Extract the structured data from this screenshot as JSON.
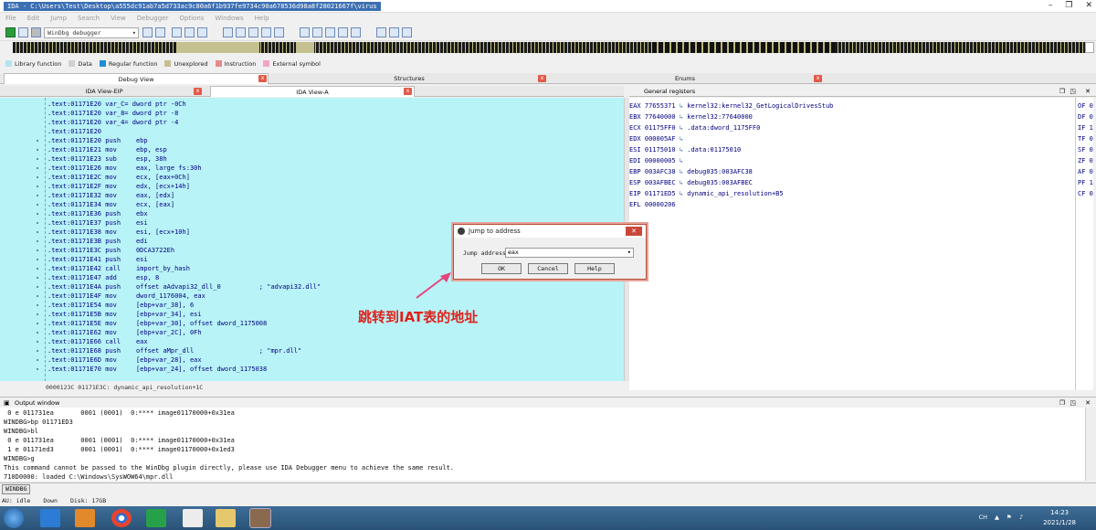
{
  "window": {
    "title": "IDA - C:\\Users\\Test\\Desktop\\a555dc91ab7a5d733ac9c80a6f1b937fe9734c90a678536d98a8f28021667f\\virus",
    "controls": [
      "–",
      "❐",
      "✕"
    ]
  },
  "menu": [
    "File",
    "Edit",
    "Jump",
    "Search",
    "View",
    "Debugger",
    "Options",
    "Windows",
    "Help"
  ],
  "toolbar": {
    "debugger_select": "WinDbg debugger"
  },
  "legend": [
    {
      "label": "Library function",
      "color": "#b5e3f3"
    },
    {
      "label": "Data",
      "color": "#d0d0d0"
    },
    {
      "label": "Regular function",
      "color": "#1e8fd6"
    },
    {
      "label": "Unexplored",
      "color": "#c4c08f"
    },
    {
      "label": "Instruction",
      "color": "#e88a8a"
    },
    {
      "label": "External symbol",
      "color": "#f2a3c6"
    }
  ],
  "top_tabs": [
    {
      "label": "Debug View"
    },
    {
      "label": "Structures"
    },
    {
      "label": "Enums"
    }
  ],
  "view_tabs": [
    {
      "label": "IDA View-EIP"
    },
    {
      "label": "IDA View-A"
    }
  ],
  "registers_title": "General registers",
  "disasm": [
    {
      "addr": ".text:01171E20",
      "text": " var_C= dword ptr -0Ch"
    },
    {
      "addr": ".text:01171E20",
      "text": " var_8= dword ptr -8"
    },
    {
      "addr": ".text:01171E20",
      "text": " var_4= dword ptr -4"
    },
    {
      "addr": ".text:01171E20",
      "text": ""
    },
    {
      "addr": ".text:01171E20",
      "text": " push    ebp"
    },
    {
      "addr": ".text:01171E21",
      "text": " mov     ebp, esp"
    },
    {
      "addr": ".text:01171E23",
      "text": " sub     esp, 38h"
    },
    {
      "addr": ".text:01171E26",
      "text": " mov     eax, large fs:30h"
    },
    {
      "addr": ".text:01171E2C",
      "text": " mov     ecx, [eax+0Ch]"
    },
    {
      "addr": ".text:01171E2F",
      "text": " mov     edx, [ecx+14h]"
    },
    {
      "addr": ".text:01171E32",
      "text": " mov     eax, [edx]"
    },
    {
      "addr": ".text:01171E34",
      "text": " mov     ecx, [eax]"
    },
    {
      "addr": ".text:01171E36",
      "text": " push    ebx"
    },
    {
      "addr": ".text:01171E37",
      "text": " push    esi"
    },
    {
      "addr": ".text:01171E38",
      "text": " mov     esi, [ecx+10h]"
    },
    {
      "addr": ".text:01171E3B",
      "text": " push    edi"
    },
    {
      "addr": ".text:01171E3C",
      "text": " push    0DCA3722Eh"
    },
    {
      "addr": ".text:01171E41",
      "text": " push    esi"
    },
    {
      "addr": ".text:01171E42",
      "text": " call    import_by_hash"
    },
    {
      "addr": ".text:01171E47",
      "text": " add     esp, 8"
    },
    {
      "addr": ".text:01171E4A",
      "text": " push    offset aAdvapi32_dll_0          ; \"advapi32.dll\""
    },
    {
      "addr": ".text:01171E4F",
      "text": " mov     dword_1176004, eax"
    },
    {
      "addr": ".text:01171E54",
      "text": " mov     [ebp+var_38], 6"
    },
    {
      "addr": ".text:01171E5B",
      "text": " mov     [ebp+var_34], esi"
    },
    {
      "addr": ".text:01171E5E",
      "text": " mov     [ebp+var_30], offset dword_1175008"
    },
    {
      "addr": ".text:01171E62",
      "text": " mov     [ebp+var_2C], 0Fh"
    },
    {
      "addr": ".text:01171E66",
      "text": " call    eax"
    },
    {
      "addr": ".text:01171E68",
      "text": " push    offset aMpr_dll                 ; \"mpr.dll\""
    },
    {
      "addr": ".text:01171E6D",
      "text": " mov     [ebp+var_28], eax"
    },
    {
      "addr": ".text:01171E70",
      "text": " mov     [ebp+var_24], offset dword_1175038"
    }
  ],
  "disasm_status": "0000123C 01171E3C: dynamic_api_resolution+1C",
  "registers": [
    {
      "name": "EAX",
      "value": "77655371",
      "target": "kernel32:kernel32_GetLogicalDrivesStub"
    },
    {
      "name": "EBX",
      "value": "77640000",
      "target": "kernel32:77640000"
    },
    {
      "name": "ECX",
      "value": "01175FF0",
      "target": ".data:dword_1175FF0"
    },
    {
      "name": "EDX",
      "value": "000005AF",
      "target": ""
    },
    {
      "name": "ESI",
      "value": "01175010",
      "target": ".data:01175010"
    },
    {
      "name": "EDI",
      "value": "00000005",
      "target": ""
    },
    {
      "name": "EBP",
      "value": "003AFC38",
      "target": "debug035:003AFC38"
    },
    {
      "name": "ESP",
      "value": "003AFBEC",
      "target": "debug035:003AFBEC"
    },
    {
      "name": "EIP",
      "value": "01171ED5",
      "target": "dynamic_api_resolution+B5"
    },
    {
      "name": "EFL",
      "value": "00000206",
      "target": ""
    }
  ],
  "flags": [
    "OF 0",
    "DF 0",
    "IF 1",
    "TF 0",
    "SF 0",
    "ZF 0",
    "AF 0",
    "PF 1",
    "CF 0"
  ],
  "dialog": {
    "title": "Jump to address",
    "label": "Jump address",
    "value": "eax",
    "ok": "OK",
    "cancel": "Cancel",
    "help": "Help"
  },
  "annotation": "跳转到IAT表的地址",
  "output_title": "Output window",
  "output": [
    " 0 e 011731ea       0001 (0001)  0:**** image01170000+0x31ea",
    "WINDBG>bp 01171ED3",
    "WINDBG>bl",
    " 0 e 011731ea       0001 (0001)  0:**** image01170000+0x31ea",
    " 1 e 01171ed3       0001 (0001)  0:**** image01170000+0x1ed3",
    "WINDBG>g",
    "This command cannot be passed to the WinDbg plugin directly, please use IDA Debugger menu to achieve the same result.",
    "710D0000: loaded C:\\Windows\\SysWOW64\\mpr.dll"
  ],
  "cmd_button": "WINDBG",
  "status": [
    "AU:  idle",
    "Down",
    "Disk: 17GB"
  ],
  "clock": {
    "time": "14:23",
    "date": "2021/1/28"
  },
  "tray": [
    "CH",
    "▲",
    "⚑",
    "♪"
  ]
}
